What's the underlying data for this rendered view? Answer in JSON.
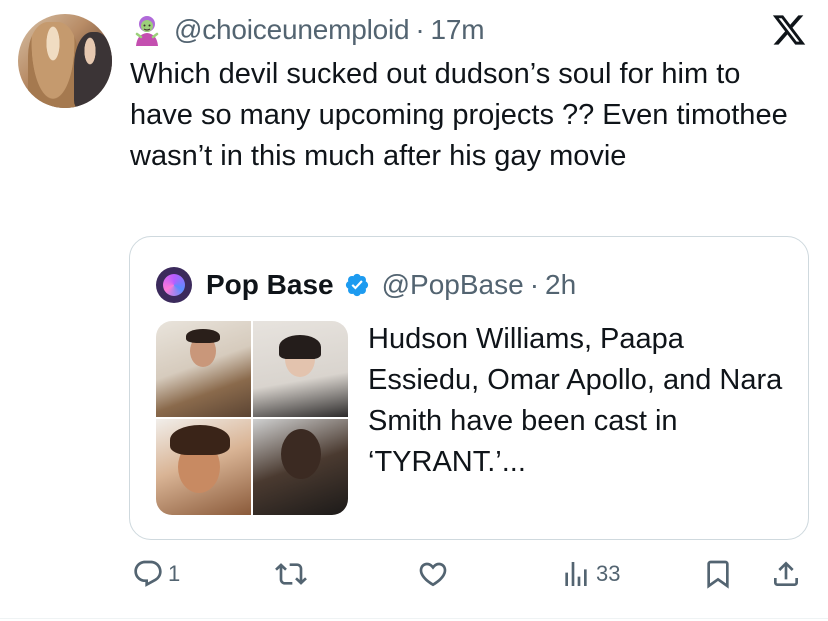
{
  "tweet": {
    "handle": "@choiceunemploid",
    "separator": "·",
    "time": "17m",
    "text": "Which devil sucked out dudson’s soul for him to have so many upcoming projects ?? Even timothee wasn’t in this much after his gay movie",
    "avatar_icon": "user-avatar",
    "emoji_icon": "zombie-woman-emoji"
  },
  "quoted": {
    "name": "Pop Base",
    "handle": "@PopBase",
    "separator": "·",
    "time": "2h",
    "text": "Hudson Williams, Paapa Essiedu, Omar Apollo, and Nara Smith have been cast in ‘TYRANT.’...",
    "verified_color": "#1d9bf0",
    "media_count": 4
  },
  "actions": {
    "reply_count": "1",
    "retweet_count": "",
    "like_count": "",
    "views_count": "33"
  },
  "colors": {
    "text": "#0f1419",
    "secondary": "#536471",
    "border": "#cfd9de",
    "brand": "#000000"
  }
}
